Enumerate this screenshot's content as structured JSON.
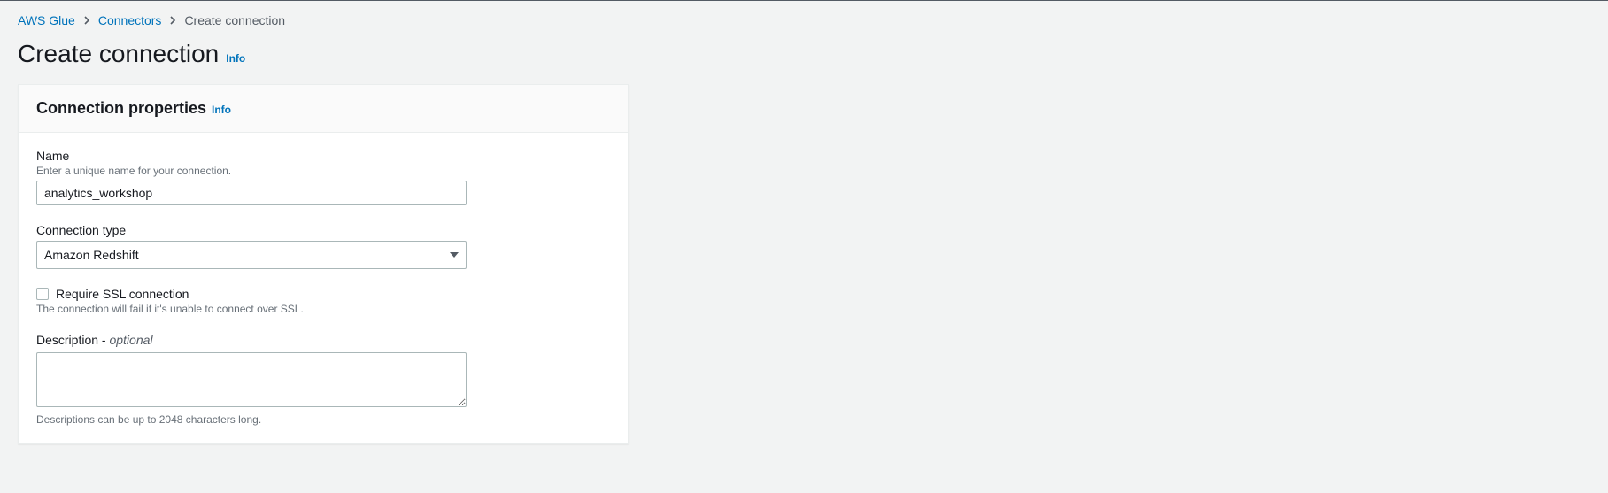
{
  "breadcrumb": {
    "items": [
      {
        "label": "AWS Glue"
      },
      {
        "label": "Connectors"
      }
    ],
    "current": "Create connection"
  },
  "page": {
    "title": "Create connection",
    "info": "Info"
  },
  "panel": {
    "title": "Connection properties",
    "info": "Info"
  },
  "fields": {
    "name": {
      "label": "Name",
      "hint": "Enter a unique name for your connection.",
      "value": "analytics_workshop"
    },
    "connection_type": {
      "label": "Connection type",
      "value": "Amazon Redshift"
    },
    "require_ssl": {
      "label": "Require SSL connection",
      "hint": "The connection will fail if it's unable to connect over SSL."
    },
    "description": {
      "label": "Description - ",
      "optional": "optional",
      "hint_below": "Descriptions can be up to 2048 characters long."
    }
  }
}
